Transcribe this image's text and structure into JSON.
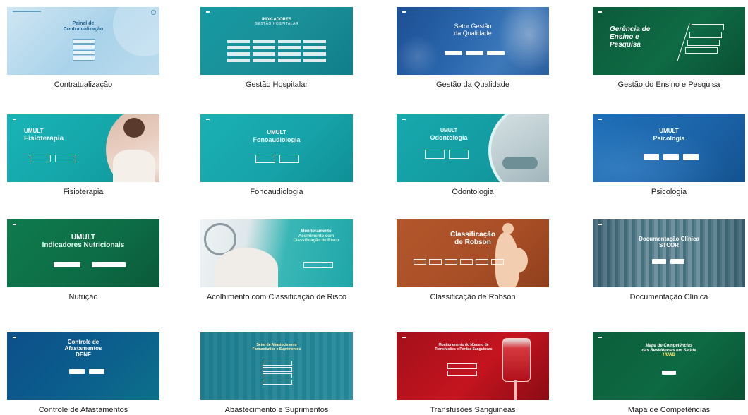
{
  "cards": [
    {
      "caption": "Contratualização",
      "thumb_title": [
        "Painel de",
        "Contratualização"
      ]
    },
    {
      "caption": "Gestão Hospitalar",
      "thumb_title": [
        "INDICADORES",
        "GESTÃO HOSPITALAR"
      ]
    },
    {
      "caption": "Gestão da Qualidade",
      "thumb_title": [
        "Setor Gestão",
        "da Qualidade"
      ]
    },
    {
      "caption": "Gestão do Ensino e Pesquisa",
      "thumb_title": [
        "Gerência de",
        "Ensino e",
        "Pesquisa"
      ]
    },
    {
      "caption": "Fisioterapia",
      "thumb_title": [
        "UMULT",
        "Fisioterapia"
      ]
    },
    {
      "caption": "Fonoaudiologia",
      "thumb_title": [
        "UMULT",
        "Fonoaudiologia"
      ]
    },
    {
      "caption": "Odontologia",
      "thumb_title": [
        "UMULT",
        "Odontologia"
      ]
    },
    {
      "caption": "Psicologia",
      "thumb_title": [
        "UMULT",
        "Psicologia"
      ]
    },
    {
      "caption": "Nutrição",
      "thumb_title": [
        "UMULT",
        "Indicadores Nutricionais"
      ]
    },
    {
      "caption": "Acolhimento com Classificação de Risco",
      "thumb_title": [
        "Monitoramento",
        "Acolhimento com",
        "Classificação de Risco"
      ]
    },
    {
      "caption": "Classificação de Robson",
      "thumb_title": [
        "Classificação",
        "de Robson"
      ]
    },
    {
      "caption": "Documentação Clínica",
      "thumb_title": [
        "Documentação Clínica",
        "STCOR"
      ]
    },
    {
      "caption": "Controle de Afastamentos",
      "thumb_title": [
        "Controle de",
        "Afastamentos",
        "DENF"
      ]
    },
    {
      "caption": "Abastecimento e Suprimentos",
      "thumb_title": [
        "Setor de Abastecimento",
        "Farmacêutico e Suprimentos"
      ]
    },
    {
      "caption": "Transfusões Sanguineas",
      "thumb_title": [
        "Monitoramento do Número de",
        "Transfusões e Perdas Sanguíneas"
      ]
    },
    {
      "caption": "Mapa de Competências",
      "thumb_title": [
        "Mapa de Competências",
        "das Residências em Saúde",
        "HUAB"
      ]
    }
  ]
}
